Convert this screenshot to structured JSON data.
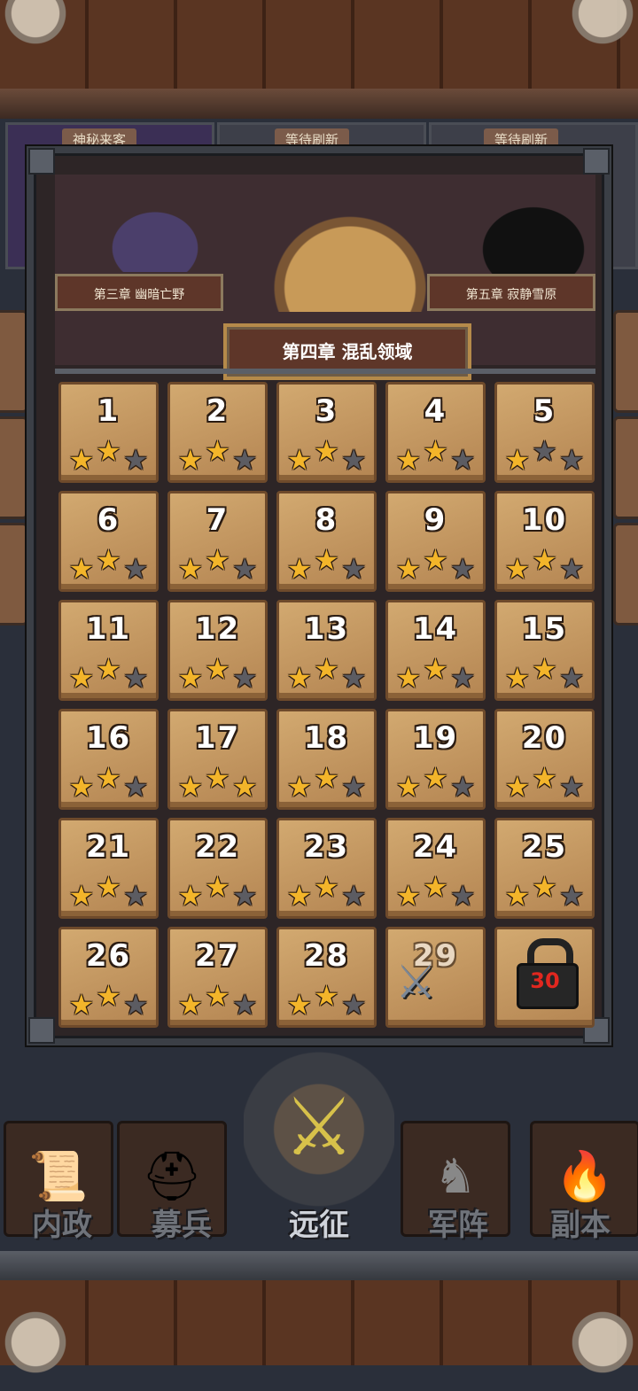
{
  "background": {
    "strip_tags": [
      "神秘来客",
      "等待刷新",
      "等待刷新"
    ]
  },
  "chapter": {
    "prev_label": "第三章 幽暗亡野",
    "next_label": "第五章 寂静雪原",
    "current_label": "第四章 混乱领域"
  },
  "levels": [
    {
      "num": "1",
      "stars": 2
    },
    {
      "num": "2",
      "stars": 2
    },
    {
      "num": "3",
      "stars": 2
    },
    {
      "num": "4",
      "stars": 2
    },
    {
      "num": "5",
      "stars": 1
    },
    {
      "num": "6",
      "stars": 2
    },
    {
      "num": "7",
      "stars": 2
    },
    {
      "num": "8",
      "stars": 2
    },
    {
      "num": "9",
      "stars": 2
    },
    {
      "num": "10",
      "stars": 2
    },
    {
      "num": "11",
      "stars": 2
    },
    {
      "num": "12",
      "stars": 2
    },
    {
      "num": "13",
      "stars": 2
    },
    {
      "num": "14",
      "stars": 2
    },
    {
      "num": "15",
      "stars": 2
    },
    {
      "num": "16",
      "stars": 2
    },
    {
      "num": "17",
      "stars": 3
    },
    {
      "num": "18",
      "stars": 2
    },
    {
      "num": "19",
      "stars": 2
    },
    {
      "num": "20",
      "stars": 2
    },
    {
      "num": "21",
      "stars": 2
    },
    {
      "num": "22",
      "stars": 2
    },
    {
      "num": "23",
      "stars": 2
    },
    {
      "num": "24",
      "stars": 2
    },
    {
      "num": "25",
      "stars": 2
    },
    {
      "num": "26",
      "stars": 2
    },
    {
      "num": "27",
      "stars": 2
    },
    {
      "num": "28",
      "stars": 2
    }
  ],
  "level_29": {
    "num": "29",
    "state": "current-battle",
    "icon": "crossed-swords-icon"
  },
  "level_30": {
    "num": "30",
    "state": "locked",
    "icon": "lock-icon"
  },
  "nav": [
    {
      "label": "内政",
      "icon": "scroll-icon",
      "active": false
    },
    {
      "label": "募兵",
      "icon": "helmet-icon",
      "active": false
    },
    {
      "label": "远征",
      "icon": "sword-emblem-icon",
      "active": true
    },
    {
      "label": "军阵",
      "icon": "chess-knight-icon",
      "active": false
    },
    {
      "label": "副本",
      "icon": "flame-banner-icon",
      "active": false
    }
  ]
}
